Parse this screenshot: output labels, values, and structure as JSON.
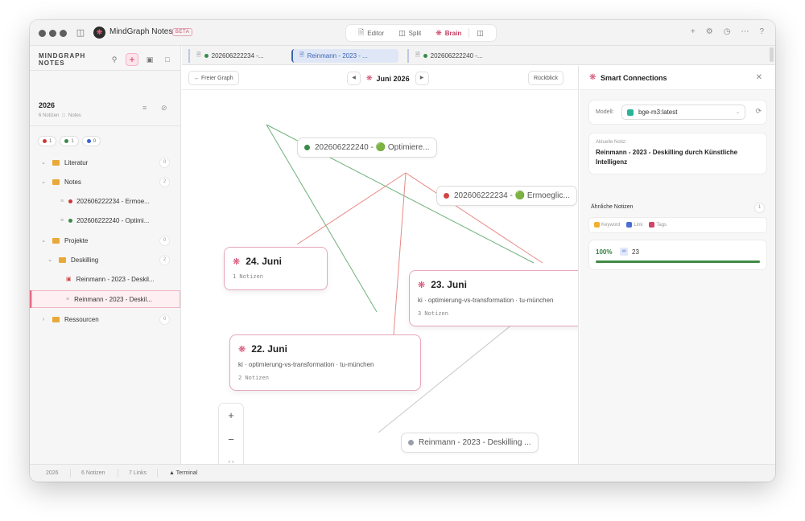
{
  "titlebar": {
    "app_name": "MindGraph Notes",
    "beta": "BETA",
    "modes": [
      {
        "icon": "document-icon",
        "label": "Editor"
      },
      {
        "icon": "split-icon",
        "label": "Split"
      },
      {
        "icon": "brain-icon",
        "label": "Brain",
        "active": true
      }
    ]
  },
  "sidebar": {
    "title": "MINDGRAPH NOTES",
    "year": "2026",
    "year_count": "6 Notizen",
    "year_folder": "Notes",
    "chips": [
      {
        "color": "#c83a3a",
        "count": "1"
      },
      {
        "color": "#3a8a4a",
        "count": "1"
      },
      {
        "color": "#3a62c8",
        "count": "0"
      }
    ],
    "tree": [
      {
        "type": "folder",
        "label": "Literatur",
        "count": "0",
        "expanded": false
      },
      {
        "type": "folder",
        "label": "Notes",
        "count": "2",
        "expanded": true
      },
      {
        "type": "note",
        "label": "202606222234 - Ermoe...",
        "dot": "#c83a3a"
      },
      {
        "type": "note",
        "label": "202606222240 - Optimi...",
        "dot": "#3a8a4a"
      },
      {
        "type": "folder",
        "label": "Projekte",
        "count": "0",
        "expanded": true
      },
      {
        "type": "folder",
        "label": "Deskilling",
        "count": "2",
        "expanded": true
      },
      {
        "type": "pdf",
        "label": "Reinmann - 2023 - Deskil..."
      },
      {
        "type": "note",
        "label": "Reinmann - 2023 - Deskil...",
        "selected": true
      },
      {
        "type": "folder",
        "label": "Ressourcen",
        "count": "0",
        "expanded": false
      }
    ]
  },
  "tabs": [
    {
      "label": "202606222234 -...",
      "dot": "#3a8a4a"
    },
    {
      "label": "Reinmann - 2023 - ...",
      "active": true
    },
    {
      "label": "202606222240 -...",
      "dot": "#3a8a4a"
    }
  ],
  "graph": {
    "free_graph_label": "← Freier Graph",
    "date_label": "Juni 2026",
    "back_label": "Rückblick",
    "notes": [
      {
        "label": "202606222240 - 🟢 Optimiere...",
        "dot": "#3a8a4a"
      },
      {
        "label": "202606222234 - 🟢 Ermoeglic...",
        "dot": "#d04444"
      },
      {
        "label": "Reinmann - 2023 - Deskilling ...",
        "dot": "#9aa0aa"
      }
    ],
    "days": [
      {
        "title": "24. Juni",
        "tags": "",
        "count": "1 Notizen"
      },
      {
        "title": "23. Juni",
        "tags": "ki · optimierung-vs-transformation · tu-münchen",
        "count": "3 Notizen"
      },
      {
        "title": "22. Juni",
        "tags": "ki · optimierung-vs-transformation · tu-münchen",
        "count": "2 Notizen"
      }
    ],
    "zoom": {
      "in": "+",
      "out": "−",
      "fit": "⛶"
    }
  },
  "panel": {
    "title": "Smart Connections",
    "model_label": "Modell:",
    "model_value": "bge-m3:latest",
    "current_note_label": "Aktuelle Notiz:",
    "current_note_title": "Reinmann - 2023 - Deskilling durch Künstliche Intelligenz",
    "similar_label": "Ähnliche Notizen",
    "similar_count": "1",
    "filters": [
      {
        "label": "Keyword",
        "color": "#f0b030"
      },
      {
        "label": "Link",
        "color": "#4a6fd0"
      },
      {
        "label": "Tags",
        "color": "#d04466"
      }
    ],
    "result": {
      "percent": "100%",
      "number": "23",
      "similarity": 1.0
    }
  },
  "statusbar": {
    "year": "2026",
    "notes": "6 Notizen",
    "links": "7 Links",
    "terminal": "▲ Terminal"
  }
}
